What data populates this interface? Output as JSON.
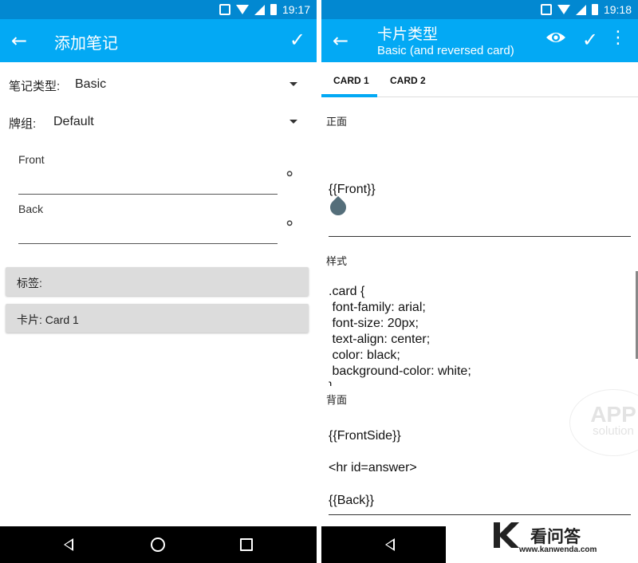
{
  "left": {
    "status": {
      "time": "19:17"
    },
    "appbar": {
      "title": "添加笔记"
    },
    "note_type": {
      "label": "笔记类型:",
      "value": "Basic"
    },
    "deck": {
      "label": "牌组:",
      "value": "Default"
    },
    "fields": [
      {
        "label": "Front",
        "value": ""
      },
      {
        "label": "Back",
        "value": ""
      }
    ],
    "tags_button": "标签:",
    "cards_button": "卡片: Card 1"
  },
  "right": {
    "status": {
      "time": "19:18"
    },
    "appbar": {
      "title": "卡片类型",
      "subtitle": "Basic (and reversed card)"
    },
    "tabs": [
      "CARD 1",
      "CARD 2"
    ],
    "front": {
      "label": "正面",
      "template": "{{Front}}"
    },
    "style": {
      "label": "样式",
      "code": ".card {\n font-family: arial;\n font-size: 20px;\n text-align: center;\n color: black;\n background-color: white;\n}"
    },
    "back": {
      "label": "背面",
      "lines": [
        "{{FrontSide}}",
        "<hr id=answer>",
        "{{Back}}"
      ]
    }
  },
  "watermark": {
    "line1": "APP",
    "line2": "solution"
  },
  "overlay_logo": {
    "brand": "看问答",
    "url": "www.kanwenda.com"
  },
  "colors": {
    "primary": "#03a9f4",
    "primary_dark": "#0288d1",
    "button_grey": "#dcdcdc"
  }
}
